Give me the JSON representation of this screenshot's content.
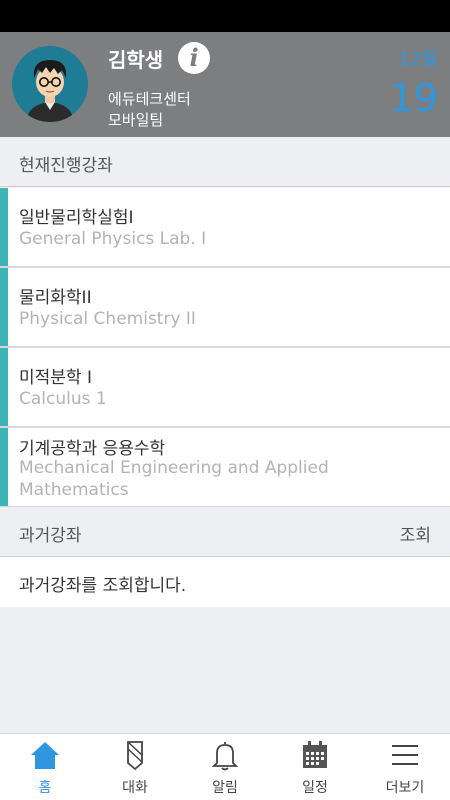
{
  "profile": {
    "name": "김학생",
    "org_line1": "에듀테크센터",
    "org_line2": "모바일팀",
    "month": "12월",
    "day": "19"
  },
  "current_section": {
    "title": "현재진행강좌"
  },
  "courses": [
    {
      "kor": "일반물리학실험I",
      "eng": "General Physics Lab. I"
    },
    {
      "kor": "물리화학II",
      "eng": "Physical Chemistry II"
    },
    {
      "kor": "미적분학 I",
      "eng": "Calculus 1"
    },
    {
      "kor": "기계공학과 응용수학",
      "eng": "Mechanical Engineering and Applied Mathematics"
    }
  ],
  "past_section": {
    "title": "과거강좌",
    "action": "조회",
    "row_text": "과거강좌를 조회합니다."
  },
  "tabs": [
    {
      "label": "홈",
      "icon": "home-icon"
    },
    {
      "label": "대화",
      "icon": "chat-icon"
    },
    {
      "label": "알림",
      "icon": "bell-icon"
    },
    {
      "label": "일정",
      "icon": "calendar-icon"
    },
    {
      "label": "더보기",
      "icon": "menu-icon"
    }
  ],
  "colors": {
    "accent": "#2f97e0",
    "course_bar": "#3eb4b6",
    "header_bg": "#7d7e80"
  }
}
